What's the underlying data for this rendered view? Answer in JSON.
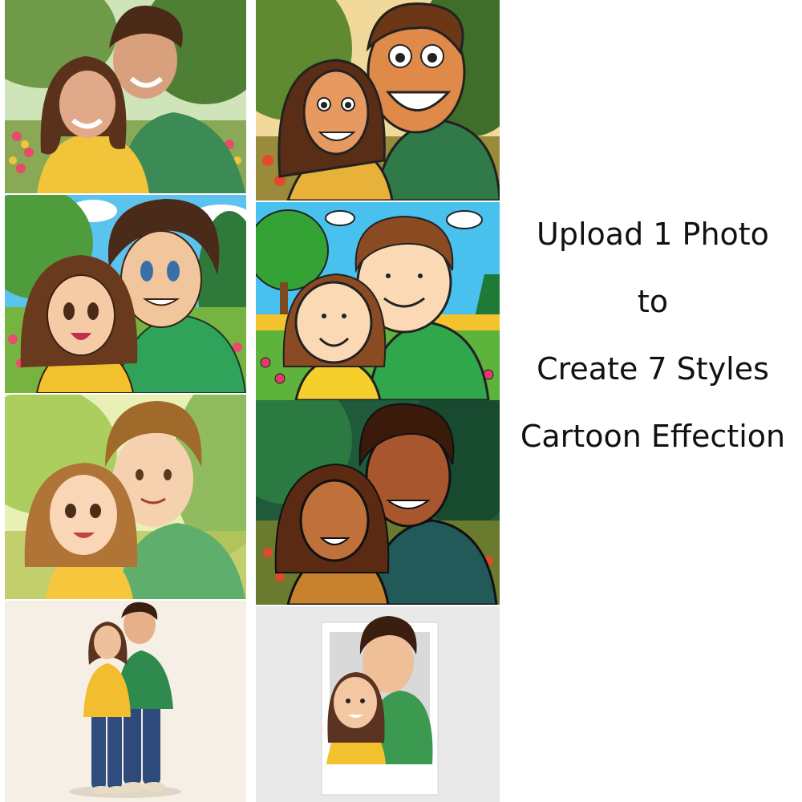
{
  "caption": {
    "line1": "Upload 1 Photo",
    "line2": "to",
    "line3": "Create 7 Styles",
    "line4": "Cartoon Effection"
  },
  "tiles": [
    {
      "style": "original photo"
    },
    {
      "style": "caricature"
    },
    {
      "style": "anime"
    },
    {
      "style": "peanuts comic"
    },
    {
      "style": "watercolor"
    },
    {
      "style": "pop art halftone"
    },
    {
      "style": "3d figure"
    },
    {
      "style": "3d polaroid"
    }
  ],
  "colors": {
    "sweater_green": "#3f9a57",
    "sweater_yellow": "#f2c12e",
    "sky": "#5bc4ee",
    "background": "#ffffff"
  }
}
